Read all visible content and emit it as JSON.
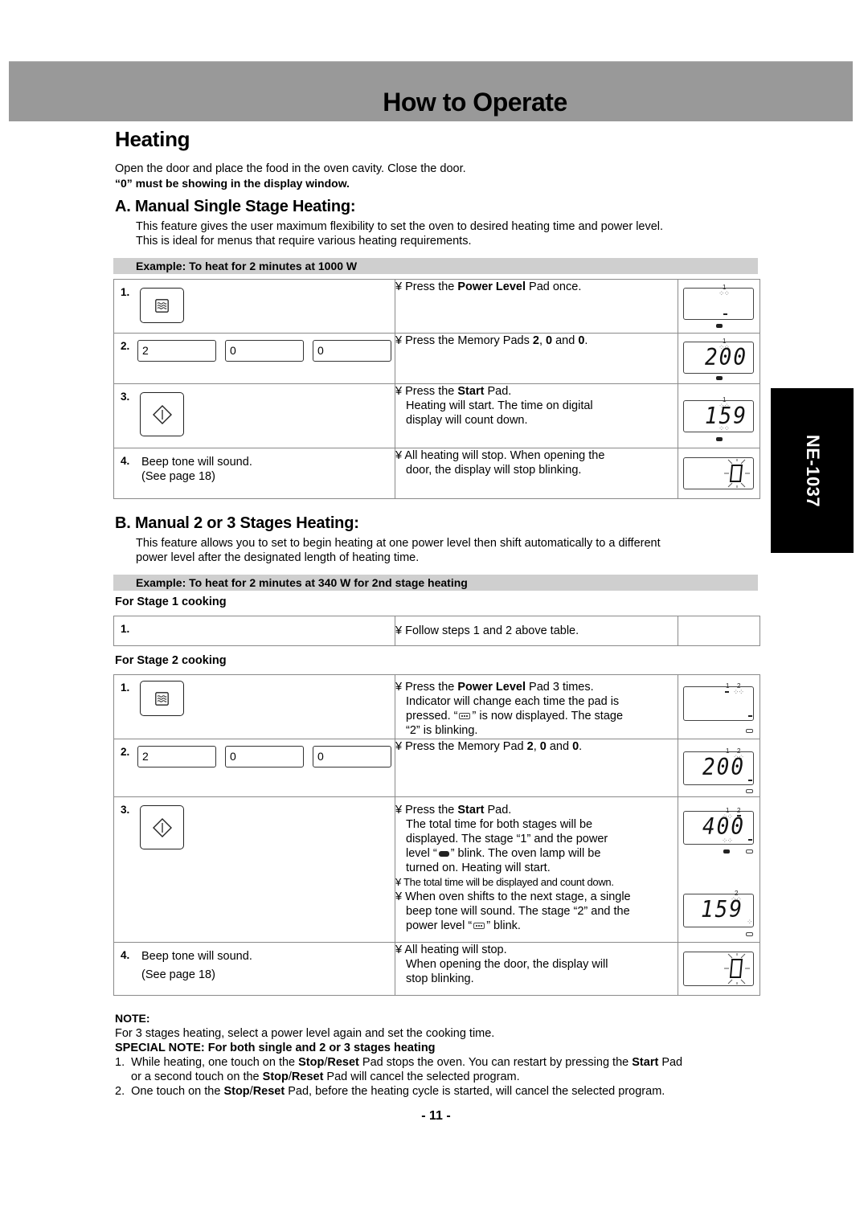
{
  "header": {
    "title": "How to Operate"
  },
  "heading": "Heating",
  "intro": {
    "line1": "Open the door and place the food in the oven cavity. Close the door.",
    "line2": "“0” must be showing in the display window."
  },
  "section_a": {
    "title": "A. Manual Single Stage Heating:",
    "desc1": "This feature gives the user maximum flexibility to set the oven to desired heating time and power level.",
    "desc2": "This is ideal for menus that require various heating requirements.",
    "example": "Example: To heat for 2 minutes at 1000 W",
    "steps": [
      {
        "num": "1.",
        "pad_icon": "power-level-pad",
        "bullet": "¥",
        "pre": "Press the ",
        "bold": "Power Level",
        "post": " Pad once.",
        "display": {
          "digits": "",
          "stage_labels": [
            "1"
          ]
        }
      },
      {
        "num": "2.",
        "pads": [
          "2",
          "0",
          "0"
        ],
        "bullet": "¥",
        "pre": "Press the Memory Pads ",
        "b1": "2",
        "mid1": ", ",
        "b2": "0",
        "mid2": " and ",
        "b3": "0",
        "post": ".",
        "display": {
          "digits": "200",
          "stage_labels": [
            "1"
          ]
        }
      },
      {
        "num": "3.",
        "pad_icon": "start-pad",
        "bullet": "¥",
        "pre": "Press the ",
        "bold": "Start",
        "post": " Pad.",
        "extra1": "Heating will start. The time on digital",
        "extra2": "display will count down.",
        "display": {
          "digits": "159",
          "stage_labels": [
            "1"
          ]
        }
      },
      {
        "num": "4.",
        "text1": "Beep tone will sound.",
        "text2": "(See page 18)",
        "bullet": "¥",
        "line1": "All heating will stop. When opening the",
        "line2": "door, the display will stop blinking.",
        "display": {
          "digits": "0"
        }
      }
    ]
  },
  "section_b": {
    "title": "B. Manual 2 or 3 Stages Heating:",
    "desc1": "This feature allows you to set to begin heating at one power level then shift automatically to a different",
    "desc2": "power level after the designated length of heating time.",
    "example": "Example: To heat for 2 minutes at 340 W for 2nd stage heating",
    "stage1_label": "For Stage 1 cooking",
    "stage1_steps": [
      {
        "num": "1.",
        "bullet": "¥",
        "text": "Follow steps 1 and 2 above table."
      }
    ],
    "stage2_label": "For Stage 2 cooking",
    "stage2_steps": [
      {
        "num": "1.",
        "pad_icon": "power-level-pad",
        "bullet": "¥",
        "pre": "Press the ",
        "bold": "Power Level",
        "post": " Pad 3 times.",
        "l2": "Indicator will change each time the pad is",
        "l3a": "pressed. “",
        "l3b": "” is now displayed. The stage",
        "l4": "“2” is blinking.",
        "display": {
          "digits": "",
          "stage_labels": [
            "1",
            "2"
          ]
        }
      },
      {
        "num": "2.",
        "pads": [
          "2",
          "0",
          "0"
        ],
        "bullet": "¥",
        "pre": "Press the Memory Pad ",
        "b1": "2",
        "mid1": ", ",
        "b2": "0",
        "mid2": " and ",
        "b3": "0",
        "post": ".",
        "display": {
          "digits": "200",
          "stage_labels": [
            "1",
            "2"
          ]
        }
      },
      {
        "num": "3.",
        "pad_icon": "start-pad",
        "bullet": "¥",
        "pre": "Press the ",
        "bold": "Start",
        "post": " Pad.",
        "l2": "The total time for both stages will be",
        "l3": "displayed. The stage “1” and the power",
        "l4a": "level “",
        "l4b": "” blink. The oven lamp will be",
        "l5": "turned on. Heating will start.",
        "b2_text": "The total time will be displayed and count down.",
        "b3_l1": "When oven shifts to the next stage, a single",
        "b3_l2": "beep tone will sound. The stage “2” and the",
        "b3_l3a": "power level “",
        "b3_l3b": "” blink.",
        "display": {
          "digits": "400",
          "stage_labels": [
            "1",
            "2"
          ]
        },
        "display2": {
          "digits": "159",
          "stage_labels": [
            "2"
          ]
        }
      },
      {
        "num": "4.",
        "text1": "Beep tone will sound.",
        "text2": "(See page 18)",
        "bullet": "¥",
        "line1": "All heating will stop.",
        "line2": "When opening the door, the display will",
        "line3": "stop blinking.",
        "display": {
          "digits": "0"
        }
      }
    ]
  },
  "side_tab": {
    "model": "NE-1037"
  },
  "note": {
    "head": "NOTE:",
    "body": "For 3 stages heating, select a power level again and set the cooking time.",
    "special_head": "SPECIAL NOTE: For both single and 2 or 3 stages heating",
    "item1_num": "1.",
    "item1_a": "While heating, one touch on the ",
    "item1_b": "Stop",
    "item1_c": "/",
    "item1_d": "Reset",
    "item1_e": " Pad stops the oven. You can restart by pressing the ",
    "item1_f": "Start",
    "item1_g": " Pad",
    "item1_h": "or a second touch on the ",
    "item1_i": "Stop",
    "item1_j": "/",
    "item1_k": "Reset",
    "item1_l": " Pad will cancel the selected program.",
    "item2_num": "2.",
    "item2_a": "One touch on the ",
    "item2_b": "Stop",
    "item2_c": "/",
    "item2_d": "Reset",
    "item2_e": " Pad, before the heating cycle is started, will cancel the selected program."
  },
  "page_number": "- 11 -",
  "colors": {
    "header_bar": "#999999",
    "example_bar": "#cfcfcf",
    "side_tab": "#000000"
  }
}
